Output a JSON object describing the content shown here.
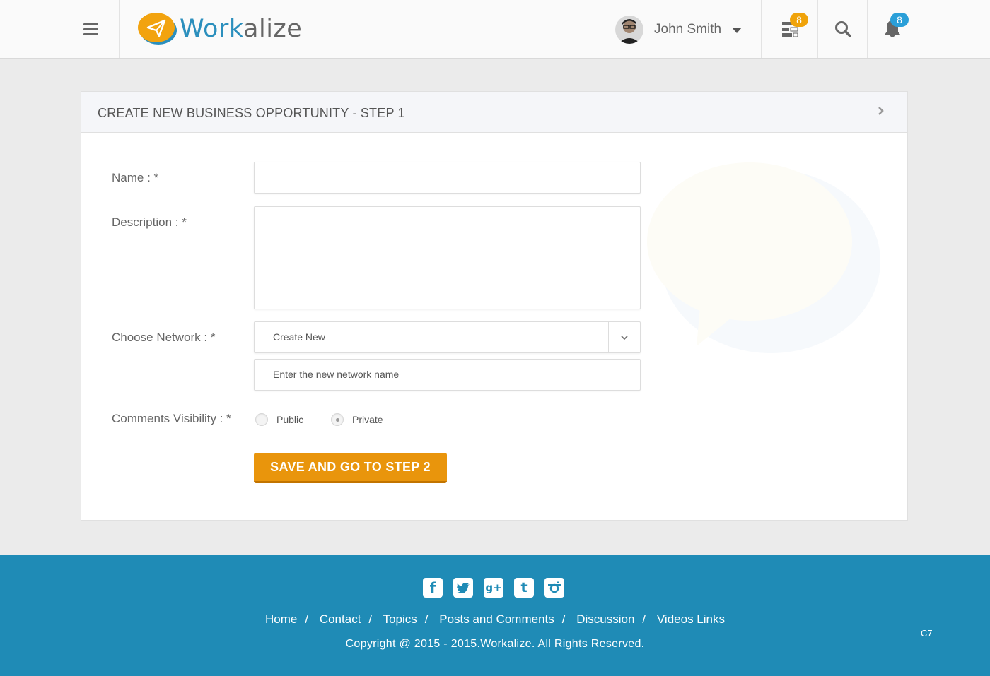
{
  "header": {
    "brand_part1": "Work",
    "brand_part2": "alize",
    "user_name": "John Smith",
    "tasks_badge": "8",
    "notifications_badge": "8",
    "colors": {
      "brand_blue": "#2b8fbd",
      "badge_orange": "#f0a30a",
      "badge_blue": "#2a9fd8"
    }
  },
  "panel": {
    "title": "CREATE NEW BUSINESS OPPORTUNITY - STEP 1",
    "form": {
      "name_label": "Name : *",
      "name_value": "",
      "description_label": "Description : *",
      "description_value": "",
      "network_label": "Choose Network : *",
      "network_selected": "Create New",
      "network_name_placeholder": "Enter the new network name",
      "visibility_label": "Comments Visibility : *",
      "visibility_options": [
        "Public",
        "Private"
      ],
      "visibility_selected": "Private",
      "submit_label": "SAVE AND GO TO STEP 2"
    },
    "colors": {
      "accent": "#e9950c"
    }
  },
  "footer": {
    "social_icons": [
      "facebook-icon",
      "twitter-icon",
      "google-plus-icon",
      "tumblr-icon",
      "instagram-icon"
    ],
    "links": [
      "Home",
      "Contact",
      "Topics",
      "Posts and Comments",
      "Discussion",
      "Videos Links"
    ],
    "copyright": "Copyright @ 2015 - 2015.Workalize. All Rights Reserved.",
    "corner_label": "C7",
    "colors": {
      "background": "#1f8bb6"
    }
  }
}
